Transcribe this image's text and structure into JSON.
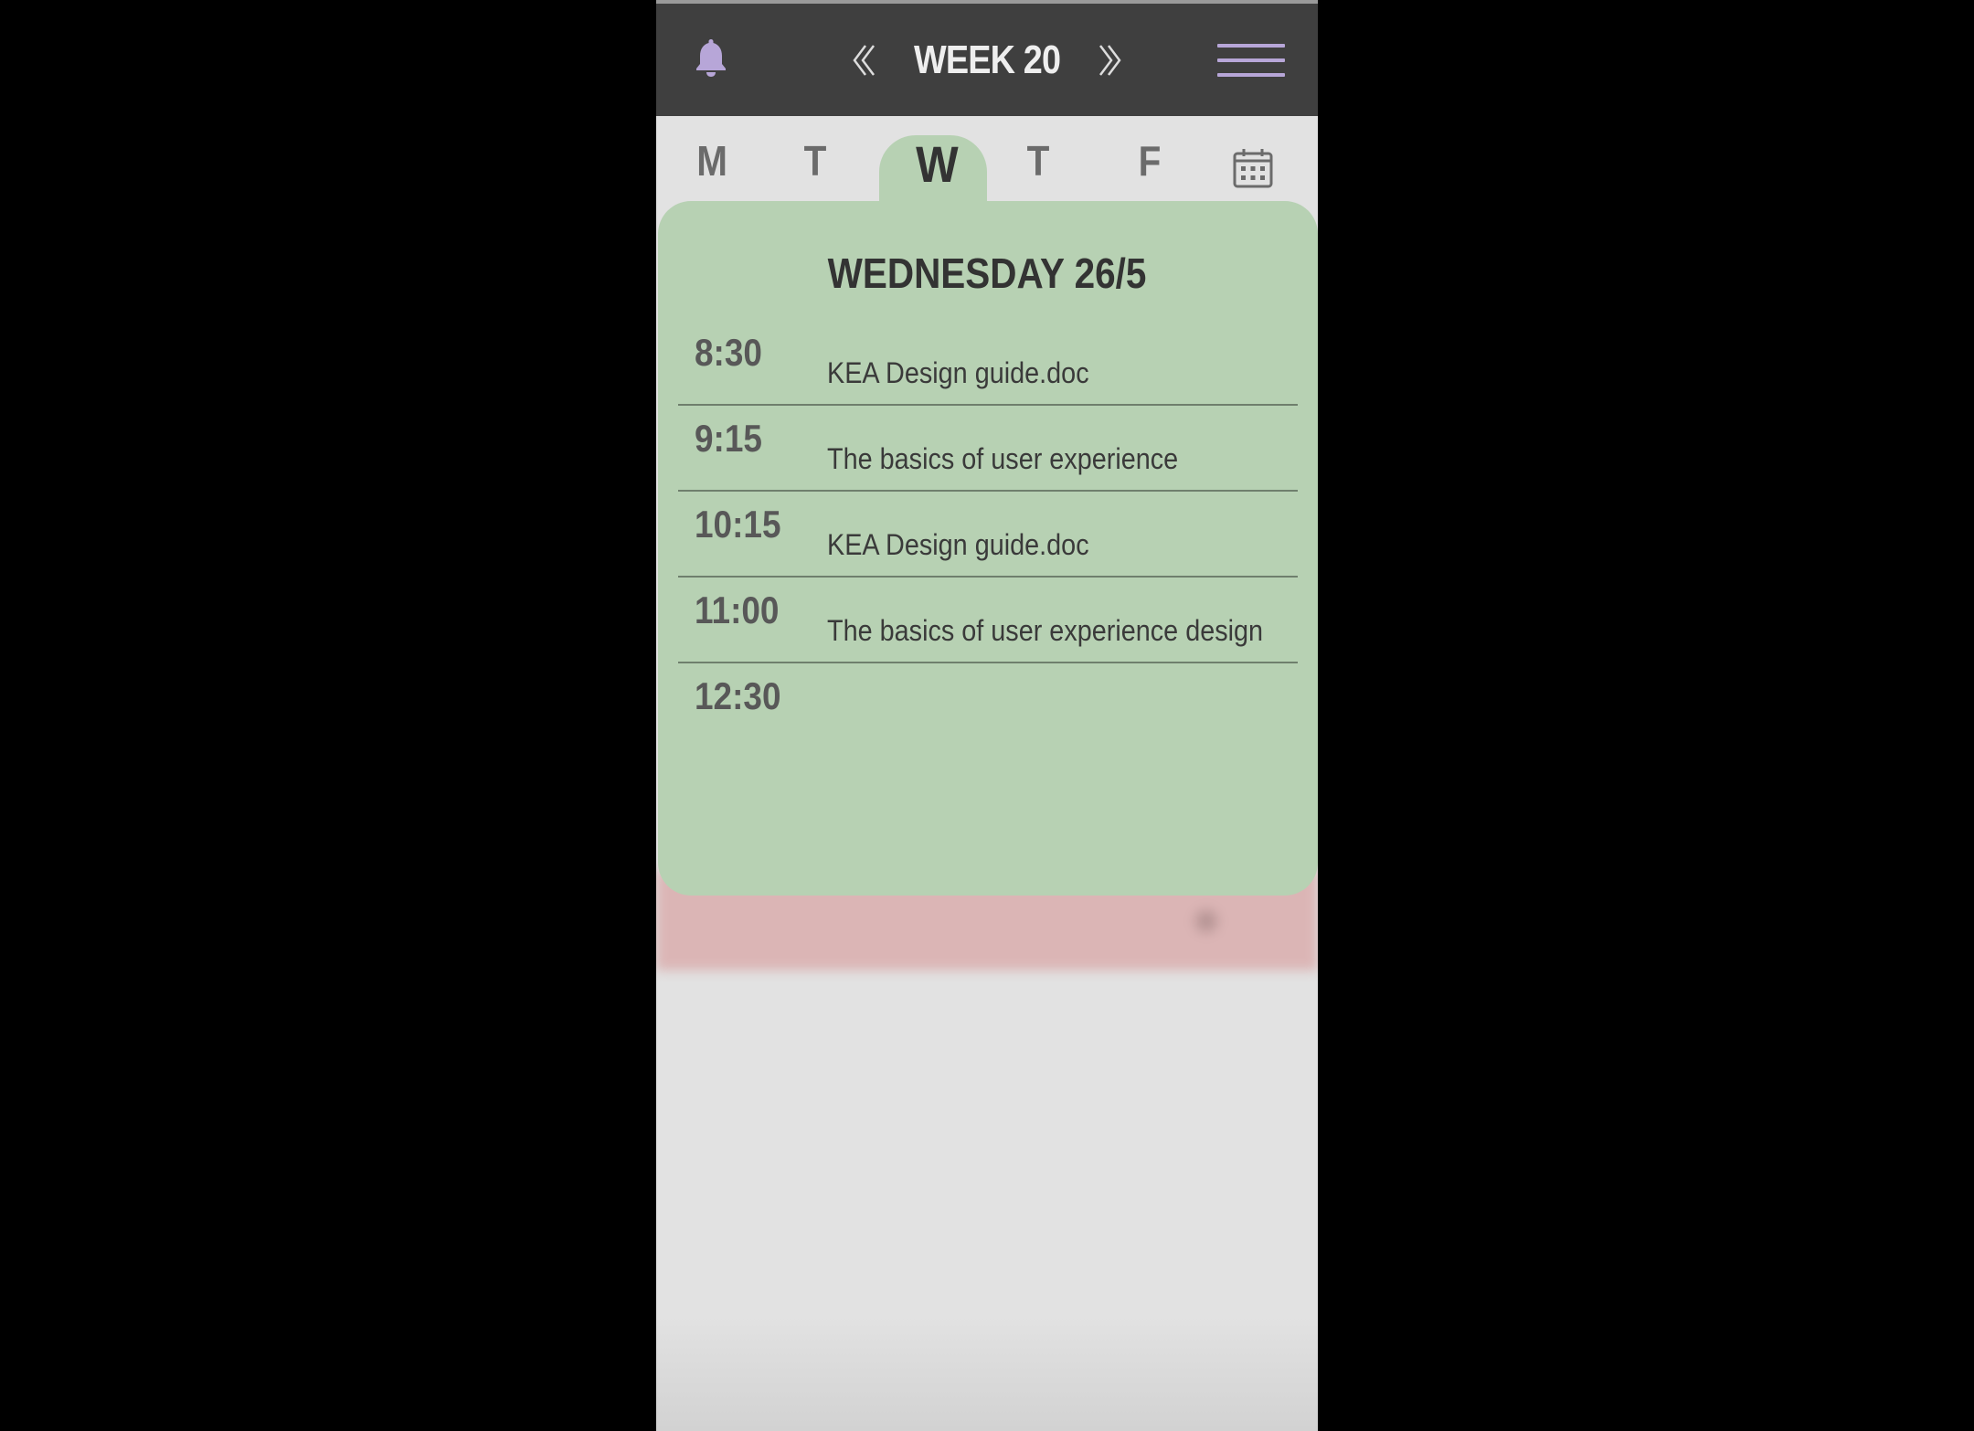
{
  "header": {
    "week_title": "WEEK 20",
    "prev_icon": "chevron-left-double-icon",
    "next_icon": "chevron-right-double-icon",
    "notification_icon": "bell-icon",
    "menu_icon": "hamburger-menu-icon"
  },
  "days": {
    "tabs": [
      {
        "label": "M",
        "active": false
      },
      {
        "label": "T",
        "active": false
      },
      {
        "label": "W",
        "active": true
      },
      {
        "label": "T",
        "active": false
      },
      {
        "label": "F",
        "active": false
      }
    ],
    "calendar_icon": "calendar-icon"
  },
  "schedule": {
    "heading": "WEDNESDAY 26/5",
    "slots": [
      {
        "time": "8:30",
        "title": "KEA Design guide.doc"
      },
      {
        "time": "9:15",
        "title": "The basics of user experience"
      },
      {
        "time": "10:15",
        "title": "KEA Design guide.doc"
      },
      {
        "time": "11:00",
        "title": "The basics of user experience design"
      },
      {
        "time": "12:30",
        "title": ""
      }
    ]
  },
  "colors": {
    "header_bg": "#3f3f3f",
    "accent_purple": "#b7a6d8",
    "day_card_green": "#b7d1b3",
    "blurred_card_pink": "#dbb5b5",
    "page_bg": "#e2e2e2"
  }
}
